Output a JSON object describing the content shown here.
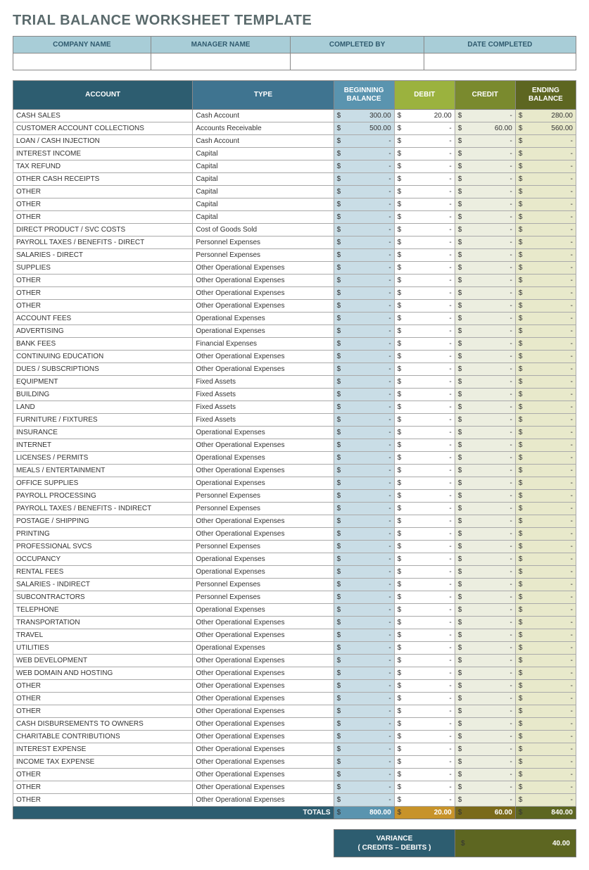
{
  "title": "TRIAL BALANCE WORKSHEET TEMPLATE",
  "meta": {
    "headers": [
      "COMPANY NAME",
      "MANAGER NAME",
      "COMPLETED BY",
      "DATE COMPLETED"
    ],
    "values": [
      "",
      "",
      "",
      ""
    ]
  },
  "columns": {
    "account": "ACCOUNT",
    "type": "TYPE",
    "beginning": "BEGINNING BALANCE",
    "debit": "DEBIT",
    "credit": "CREDIT",
    "ending": "ENDING BALANCE"
  },
  "currency": "$",
  "empty": "-",
  "rows": [
    {
      "account": "CASH SALES",
      "type": "Cash Account",
      "begin": "300.00",
      "debit": "20.00",
      "credit": "-",
      "end": "280.00"
    },
    {
      "account": "CUSTOMER ACCOUNT COLLECTIONS",
      "type": "Accounts Receivable",
      "begin": "500.00",
      "debit": "-",
      "credit": "60.00",
      "end": "560.00"
    },
    {
      "account": "LOAN / CASH INJECTION",
      "type": "Cash Account",
      "begin": "-",
      "debit": "-",
      "credit": "-",
      "end": "-"
    },
    {
      "account": "INTEREST INCOME",
      "type": "Capital",
      "begin": "-",
      "debit": "-",
      "credit": "-",
      "end": "-"
    },
    {
      "account": "TAX REFUND",
      "type": "Capital",
      "begin": "-",
      "debit": "-",
      "credit": "-",
      "end": "-"
    },
    {
      "account": "OTHER CASH RECEIPTS",
      "type": "Capital",
      "begin": "-",
      "debit": "-",
      "credit": "-",
      "end": "-"
    },
    {
      "account": "OTHER",
      "type": "Capital",
      "begin": "-",
      "debit": "-",
      "credit": "-",
      "end": "-"
    },
    {
      "account": "OTHER",
      "type": "Capital",
      "begin": "-",
      "debit": "-",
      "credit": "-",
      "end": "-"
    },
    {
      "account": "OTHER",
      "type": "Capital",
      "begin": "-",
      "debit": "-",
      "credit": "-",
      "end": "-"
    },
    {
      "account": "DIRECT PRODUCT / SVC COSTS",
      "type": "Cost of Goods Sold",
      "begin": "-",
      "debit": "-",
      "credit": "-",
      "end": "-"
    },
    {
      "account": "PAYROLL TAXES / BENEFITS - DIRECT",
      "type": "Personnel Expenses",
      "begin": "-",
      "debit": "-",
      "credit": "-",
      "end": "-"
    },
    {
      "account": "SALARIES - DIRECT",
      "type": "Personnel Expenses",
      "begin": "-",
      "debit": "-",
      "credit": "-",
      "end": "-"
    },
    {
      "account": "SUPPLIES",
      "type": "Other Operational Expenses",
      "begin": "-",
      "debit": "-",
      "credit": "-",
      "end": "-"
    },
    {
      "account": "OTHER",
      "type": "Other Operational Expenses",
      "begin": "-",
      "debit": "-",
      "credit": "-",
      "end": "-"
    },
    {
      "account": "OTHER",
      "type": "Other Operational Expenses",
      "begin": "-",
      "debit": "-",
      "credit": "-",
      "end": "-"
    },
    {
      "account": "OTHER",
      "type": "Other Operational Expenses",
      "begin": "-",
      "debit": "-",
      "credit": "-",
      "end": "-"
    },
    {
      "account": "ACCOUNT FEES",
      "type": "Operational Expenses",
      "begin": "-",
      "debit": "-",
      "credit": "-",
      "end": "-"
    },
    {
      "account": "ADVERTISING",
      "type": "Operational Expenses",
      "begin": "-",
      "debit": "-",
      "credit": "-",
      "end": "-"
    },
    {
      "account": "BANK FEES",
      "type": "Financial Expenses",
      "begin": "-",
      "debit": "-",
      "credit": "-",
      "end": "-"
    },
    {
      "account": "CONTINUING EDUCATION",
      "type": "Other Operational Expenses",
      "begin": "-",
      "debit": "-",
      "credit": "-",
      "end": "-"
    },
    {
      "account": "DUES / SUBSCRIPTIONS",
      "type": "Other Operational Expenses",
      "begin": "-",
      "debit": "-",
      "credit": "-",
      "end": "-"
    },
    {
      "account": "EQUIPMENT",
      "type": "Fixed Assets",
      "begin": "-",
      "debit": "-",
      "credit": "-",
      "end": "-"
    },
    {
      "account": "BUILDING",
      "type": "Fixed Assets",
      "begin": "-",
      "debit": "-",
      "credit": "-",
      "end": "-"
    },
    {
      "account": "LAND",
      "type": "Fixed Assets",
      "begin": "-",
      "debit": "-",
      "credit": "-",
      "end": "-"
    },
    {
      "account": "FURNITURE / FIXTURES",
      "type": "Fixed Assets",
      "begin": "-",
      "debit": "-",
      "credit": "-",
      "end": "-"
    },
    {
      "account": "INSURANCE",
      "type": "Operational Expenses",
      "begin": "-",
      "debit": "-",
      "credit": "-",
      "end": "-"
    },
    {
      "account": "INTERNET",
      "type": "Other Operational Expenses",
      "begin": "-",
      "debit": "-",
      "credit": "-",
      "end": "-"
    },
    {
      "account": "LICENSES / PERMITS",
      "type": "Operational Expenses",
      "begin": "-",
      "debit": "-",
      "credit": "-",
      "end": "-"
    },
    {
      "account": "MEALS / ENTERTAINMENT",
      "type": "Other Operational Expenses",
      "begin": "-",
      "debit": "-",
      "credit": "-",
      "end": "-"
    },
    {
      "account": "OFFICE SUPPLIES",
      "type": "Operational Expenses",
      "begin": "-",
      "debit": "-",
      "credit": "-",
      "end": "-"
    },
    {
      "account": "PAYROLL PROCESSING",
      "type": "Personnel Expenses",
      "begin": "-",
      "debit": "-",
      "credit": "-",
      "end": "-"
    },
    {
      "account": "PAYROLL TAXES / BENEFITS - INDIRECT",
      "type": "Personnel Expenses",
      "begin": "-",
      "debit": "-",
      "credit": "-",
      "end": "-"
    },
    {
      "account": "POSTAGE / SHIPPING",
      "type": "Other Operational Expenses",
      "begin": "-",
      "debit": "-",
      "credit": "-",
      "end": "-"
    },
    {
      "account": "PRINTING",
      "type": "Other Operational Expenses",
      "begin": "-",
      "debit": "-",
      "credit": "-",
      "end": "-"
    },
    {
      "account": "PROFESSIONAL SVCS",
      "type": "Personnel Expenses",
      "begin": "-",
      "debit": "-",
      "credit": "-",
      "end": "-"
    },
    {
      "account": "OCCUPANCY",
      "type": "Operational Expenses",
      "begin": "-",
      "debit": "-",
      "credit": "-",
      "end": "-"
    },
    {
      "account": "RENTAL FEES",
      "type": "Operational Expenses",
      "begin": "-",
      "debit": "-",
      "credit": "-",
      "end": "-"
    },
    {
      "account": "SALARIES - INDIRECT",
      "type": "Personnel Expenses",
      "begin": "-",
      "debit": "-",
      "credit": "-",
      "end": "-"
    },
    {
      "account": "SUBCONTRACTORS",
      "type": "Personnel Expenses",
      "begin": "-",
      "debit": "-",
      "credit": "-",
      "end": "-"
    },
    {
      "account": "TELEPHONE",
      "type": "Operational Expenses",
      "begin": "-",
      "debit": "-",
      "credit": "-",
      "end": "-"
    },
    {
      "account": "TRANSPORTATION",
      "type": "Other Operational Expenses",
      "begin": "-",
      "debit": "-",
      "credit": "-",
      "end": "-"
    },
    {
      "account": "TRAVEL",
      "type": "Other Operational Expenses",
      "begin": "-",
      "debit": "-",
      "credit": "-",
      "end": "-"
    },
    {
      "account": "UTILITIES",
      "type": "Operational Expenses",
      "begin": "-",
      "debit": "-",
      "credit": "-",
      "end": "-"
    },
    {
      "account": "WEB DEVELOPMENT",
      "type": "Other Operational Expenses",
      "begin": "-",
      "debit": "-",
      "credit": "-",
      "end": "-"
    },
    {
      "account": "WEB DOMAIN AND HOSTING",
      "type": "Other Operational Expenses",
      "begin": "-",
      "debit": "-",
      "credit": "-",
      "end": "-"
    },
    {
      "account": "OTHER",
      "type": "Other Operational Expenses",
      "begin": "-",
      "debit": "-",
      "credit": "-",
      "end": "-"
    },
    {
      "account": "OTHER",
      "type": "Other Operational Expenses",
      "begin": "-",
      "debit": "-",
      "credit": "-",
      "end": "-"
    },
    {
      "account": "OTHER",
      "type": "Other Operational Expenses",
      "begin": "-",
      "debit": "-",
      "credit": "-",
      "end": "-"
    },
    {
      "account": "CASH DISBURSEMENTS TO OWNERS",
      "type": "Other Operational Expenses",
      "begin": "-",
      "debit": "-",
      "credit": "-",
      "end": "-"
    },
    {
      "account": "CHARITABLE CONTRIBUTIONS",
      "type": "Other Operational Expenses",
      "begin": "-",
      "debit": "-",
      "credit": "-",
      "end": "-"
    },
    {
      "account": "INTEREST EXPENSE",
      "type": "Other Operational Expenses",
      "begin": "-",
      "debit": "-",
      "credit": "-",
      "end": "-"
    },
    {
      "account": "INCOME TAX EXPENSE",
      "type": "Other Operational Expenses",
      "begin": "-",
      "debit": "-",
      "credit": "-",
      "end": "-"
    },
    {
      "account": "OTHER",
      "type": "Other Operational Expenses",
      "begin": "-",
      "debit": "-",
      "credit": "-",
      "end": "-"
    },
    {
      "account": "OTHER",
      "type": "Other Operational Expenses",
      "begin": "-",
      "debit": "-",
      "credit": "-",
      "end": "-"
    },
    {
      "account": "OTHER",
      "type": "Other Operational Expenses",
      "begin": "-",
      "debit": "-",
      "credit": "-",
      "end": "-"
    }
  ],
  "totals": {
    "label": "TOTALS",
    "begin": "800.00",
    "debit": "20.00",
    "credit": "60.00",
    "end": "840.00"
  },
  "variance": {
    "label": "VARIANCE\n( CREDITS – DEBITS )",
    "value": "40.00"
  }
}
